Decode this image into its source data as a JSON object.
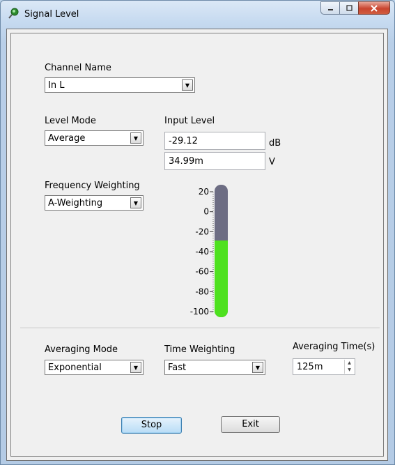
{
  "window": {
    "title": "Signal Level"
  },
  "channel": {
    "label": "Channel Name",
    "value": "In L"
  },
  "level_mode": {
    "label": "Level Mode",
    "value": "Average"
  },
  "input_level": {
    "label": "Input Level",
    "db_value": "-29.12",
    "db_unit": "dB",
    "v_value": "34.99m",
    "v_unit": "V"
  },
  "freq_weighting": {
    "label": "Frequency Weighting",
    "value": "A-Weighting"
  },
  "meter": {
    "ticks": [
      "20",
      "0",
      "-20",
      "-40",
      "-60",
      "-80",
      "-100"
    ],
    "min": -100,
    "max": 20,
    "level_db": -29.12,
    "fill_color": "#4ee11f",
    "empty_color": "#6d6d83"
  },
  "averaging_mode": {
    "label": "Averaging Mode",
    "value": "Exponential"
  },
  "time_weighting": {
    "label": "Time Weighting",
    "value": "Fast"
  },
  "averaging_time": {
    "label": "Averaging Time(s)",
    "value": "125m"
  },
  "buttons": {
    "stop": "Stop",
    "exit": "Exit"
  }
}
